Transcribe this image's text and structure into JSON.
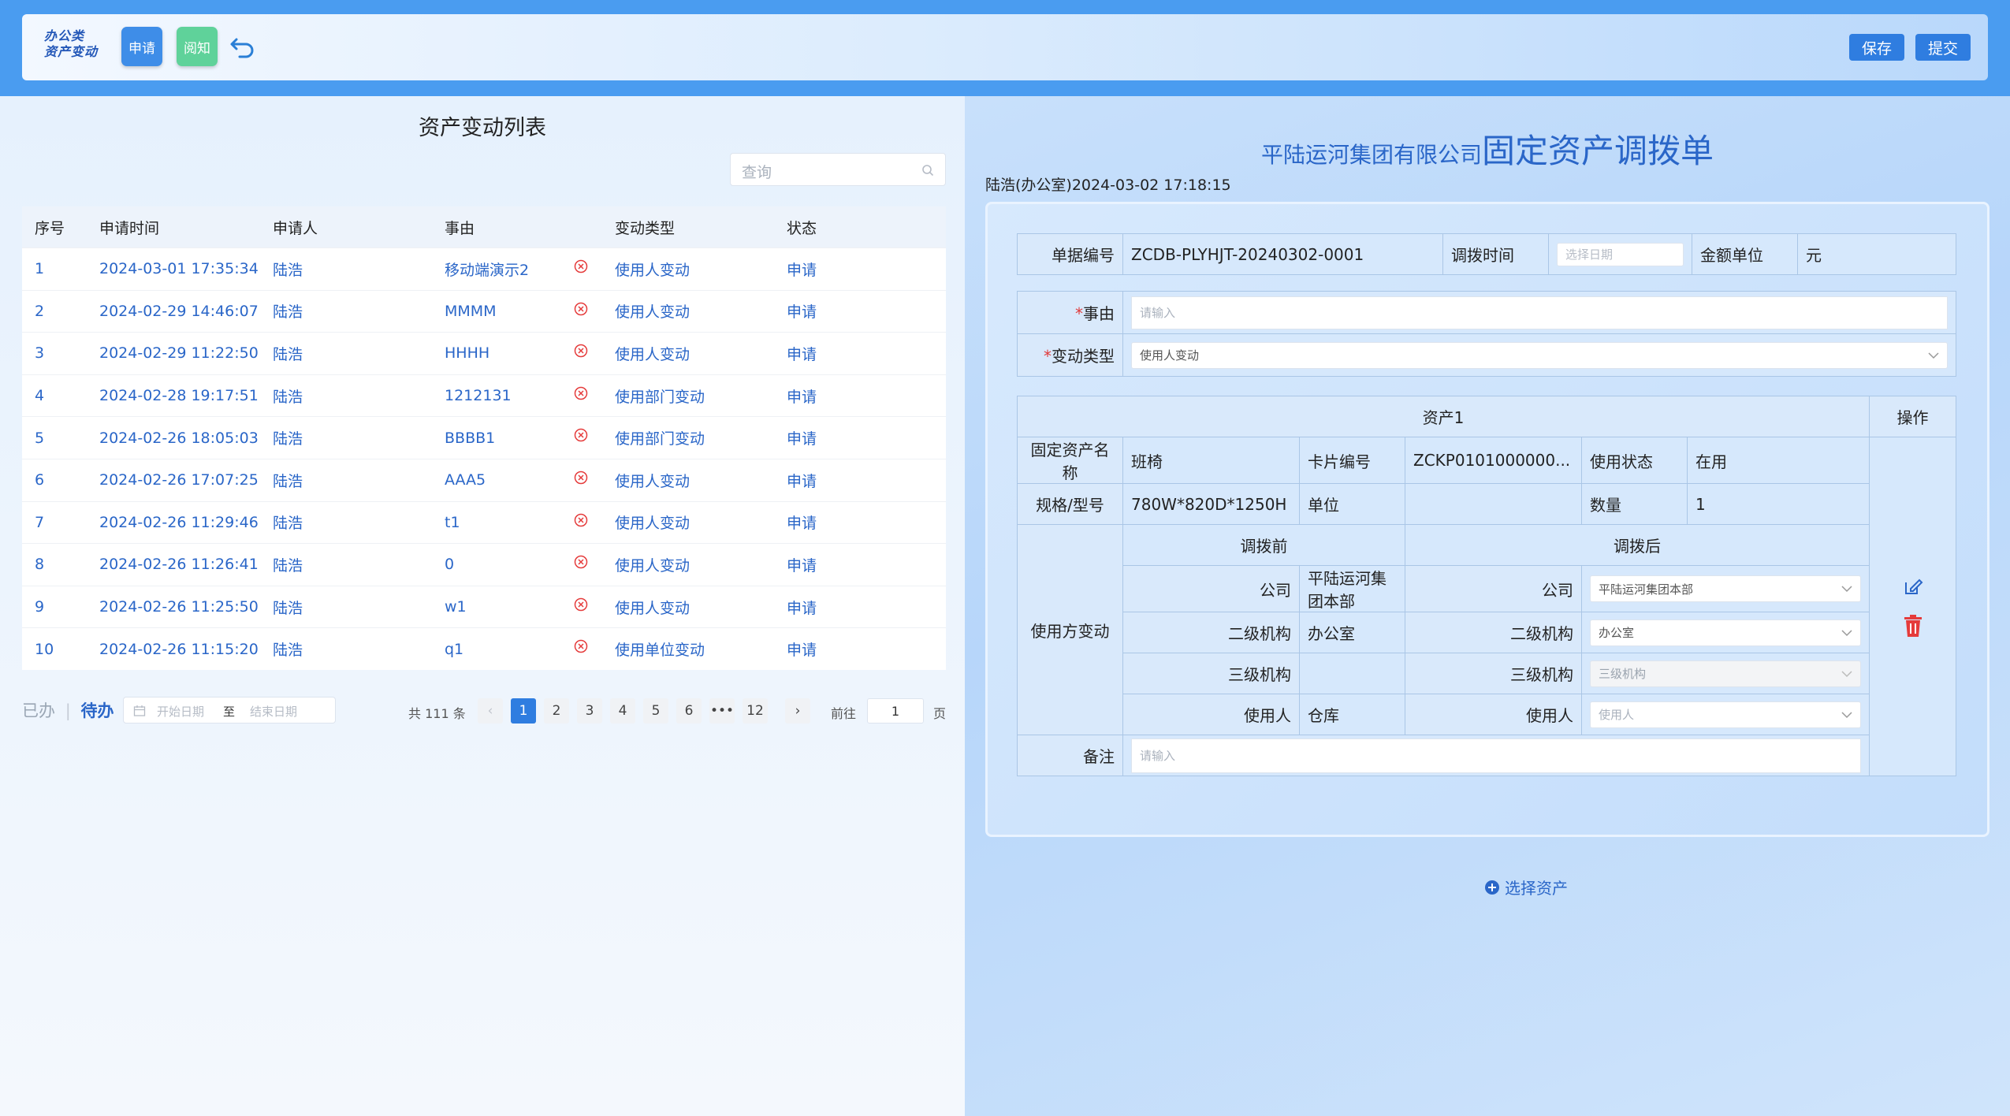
{
  "header": {
    "logo_line1": "办公类",
    "logo_line2": "资产变动",
    "apply_label": "申请",
    "read_label": "阅知",
    "save_label": "保存",
    "submit_label": "提交",
    "accent": "#2f7de0"
  },
  "list": {
    "title": "资产变动列表",
    "search_placeholder": "查询",
    "columns": [
      "序号",
      "申请时间",
      "申请人",
      "事由",
      "变动类型",
      "状态"
    ],
    "rows": [
      {
        "no": "1",
        "time": "2024-03-01 17:35:34",
        "applicant": "陆浩",
        "reason": "移动端演示2",
        "type": "使用人变动",
        "status": "申请"
      },
      {
        "no": "2",
        "time": "2024-02-29 14:46:07",
        "applicant": "陆浩",
        "reason": "MMMM",
        "type": "使用人变动",
        "status": "申请"
      },
      {
        "no": "3",
        "time": "2024-02-29 11:22:50",
        "applicant": "陆浩",
        "reason": "HHHH",
        "type": "使用人变动",
        "status": "申请"
      },
      {
        "no": "4",
        "time": "2024-02-28 19:17:51",
        "applicant": "陆浩",
        "reason": "1212131",
        "type": "使用部门变动",
        "status": "申请"
      },
      {
        "no": "5",
        "time": "2024-02-26 18:05:03",
        "applicant": "陆浩",
        "reason": "BBBB1",
        "type": "使用部门变动",
        "status": "申请"
      },
      {
        "no": "6",
        "time": "2024-02-26 17:07:25",
        "applicant": "陆浩",
        "reason": "AAA5",
        "type": "使用人变动",
        "status": "申请"
      },
      {
        "no": "7",
        "time": "2024-02-26 11:29:46",
        "applicant": "陆浩",
        "reason": "t1",
        "type": "使用人变动",
        "status": "申请"
      },
      {
        "no": "8",
        "time": "2024-02-26 11:26:41",
        "applicant": "陆浩",
        "reason": "0",
        "type": "使用人变动",
        "status": "申请"
      },
      {
        "no": "9",
        "time": "2024-02-26 11:25:50",
        "applicant": "陆浩",
        "reason": "w1",
        "type": "使用人变动",
        "status": "申请"
      },
      {
        "no": "10",
        "time": "2024-02-26 11:15:20",
        "applicant": "陆浩",
        "reason": "q1",
        "type": "使用单位变动",
        "status": "申请"
      }
    ],
    "tab_done": "已办",
    "tab_todo": "待办",
    "start_date_ph": "开始日期",
    "date_sep": "至",
    "end_date_ph": "结束日期",
    "total": "共 111 条",
    "pages": [
      "1",
      "2",
      "3",
      "4",
      "5",
      "6",
      "•••",
      "12"
    ],
    "current_page": "1",
    "goto_label": "前往",
    "goto_value": "1",
    "page_suffix": "页"
  },
  "form": {
    "company": "平陆运河集团有限公司",
    "doc_title": "固定资产调拨单",
    "creator": "陆浩(办公室)2024-03-02 17:18:15",
    "doc_no_label": "单据编号",
    "doc_no": "ZCDB-PLYHJT-20240302-0001",
    "transfer_time_label": "调拨时间",
    "date_placeholder": "选择日期",
    "amount_unit_label": "金额单位",
    "amount_unit": "元",
    "reason_label": "事由",
    "reason_placeholder": "请输入",
    "change_type_label": "变动类型",
    "change_type": "使用人变动",
    "asset_header": "资产1",
    "operation_label": "操作",
    "asset_name_label": "固定资产名称",
    "asset_name": "班椅",
    "card_no_label": "卡片编号",
    "card_no": "ZCKP0101000000...",
    "use_status_label": "使用状态",
    "use_status": "在用",
    "spec_label": "规格/型号",
    "spec": "780W*820D*1250H",
    "unit_label": "单位",
    "unit": "",
    "qty_label": "数量",
    "qty": "1",
    "user_change_label": "使用方变动",
    "before_label": "调拨前",
    "after_label": "调拨后",
    "company_label": "公司",
    "before_company": "平陆运河集团本部",
    "after_company": "平陆运河集团本部",
    "org2_label": "二级机构",
    "before_org2": "办公室",
    "after_org2": "办公室",
    "org3_label": "三级机构",
    "before_org3": "",
    "after_org3_ph": "三级机构",
    "user_label": "使用人",
    "before_user": "仓库",
    "after_user_ph": "使用人",
    "remark_label": "备注",
    "remark_placeholder": "请输入",
    "select_asset_label": "选择资产"
  }
}
